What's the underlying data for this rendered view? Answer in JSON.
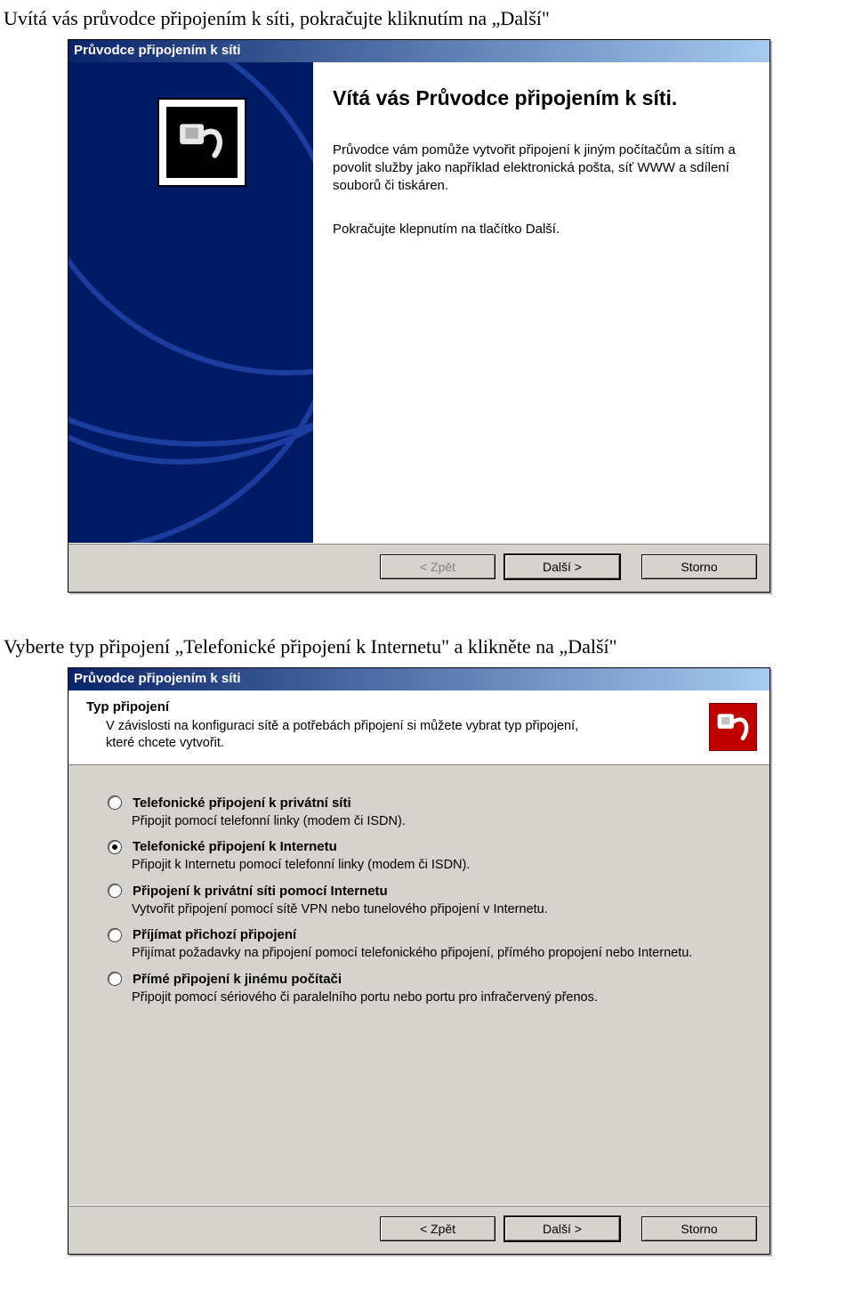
{
  "captions": {
    "top": "Uvítá vás průvodce připojením k síti, pokračujte kliknutím na „Další\"",
    "mid": "Vyberte typ připojení „Telefonické připojení k Internetu\" a klikněte na „Další\""
  },
  "dialog1": {
    "title": "Průvodce připojením k síti",
    "heading": "Vítá vás Průvodce připojením k síti.",
    "para1": "Průvodce vám pomůže vytvořit připojení k jiným počítačům a sítím a povolit služby jako například elektronická pošta, síť WWW a sdílení souborů či tiskáren.",
    "para2": "Pokračujte klepnutím na tlačítko Další.",
    "buttons": {
      "back": "< Zpět",
      "next": "Další >",
      "cancel": "Storno"
    }
  },
  "dialog2": {
    "title": "Průvodce připojením k síti",
    "header": {
      "title": "Typ připojení",
      "sub": "V závislosti na konfiguraci sítě a potřebách připojení si můžete vybrat typ připojení, které chcete vytvořit."
    },
    "options": [
      {
        "label": "Telefonické připojení k privátní síti",
        "desc": "Připojit pomocí telefonní linky (modem či ISDN).",
        "selected": false
      },
      {
        "label": "Telefonické připojení k Internetu",
        "desc": "Připojit k Internetu pomocí telefonní linky (modem či ISDN).",
        "selected": true
      },
      {
        "label": "Připojení k privátní síti pomocí Internetu",
        "desc": "Vytvořit připojení pomocí sítě VPN nebo tunelového připojení v Internetu.",
        "selected": false
      },
      {
        "label": "Příjímat přichozí připojení",
        "desc": "Přijímat požadavky na připojení pomocí telefonického připojení, přímého propojení nebo Internetu.",
        "selected": false
      },
      {
        "label": "Přímé připojení k jinému počítači",
        "desc": "Připojit pomocí sériového či paralelního portu nebo portu pro infračervený přenos.",
        "selected": false
      }
    ],
    "buttons": {
      "back": "< Zpět",
      "next": "Další >",
      "cancel": "Storno"
    }
  }
}
